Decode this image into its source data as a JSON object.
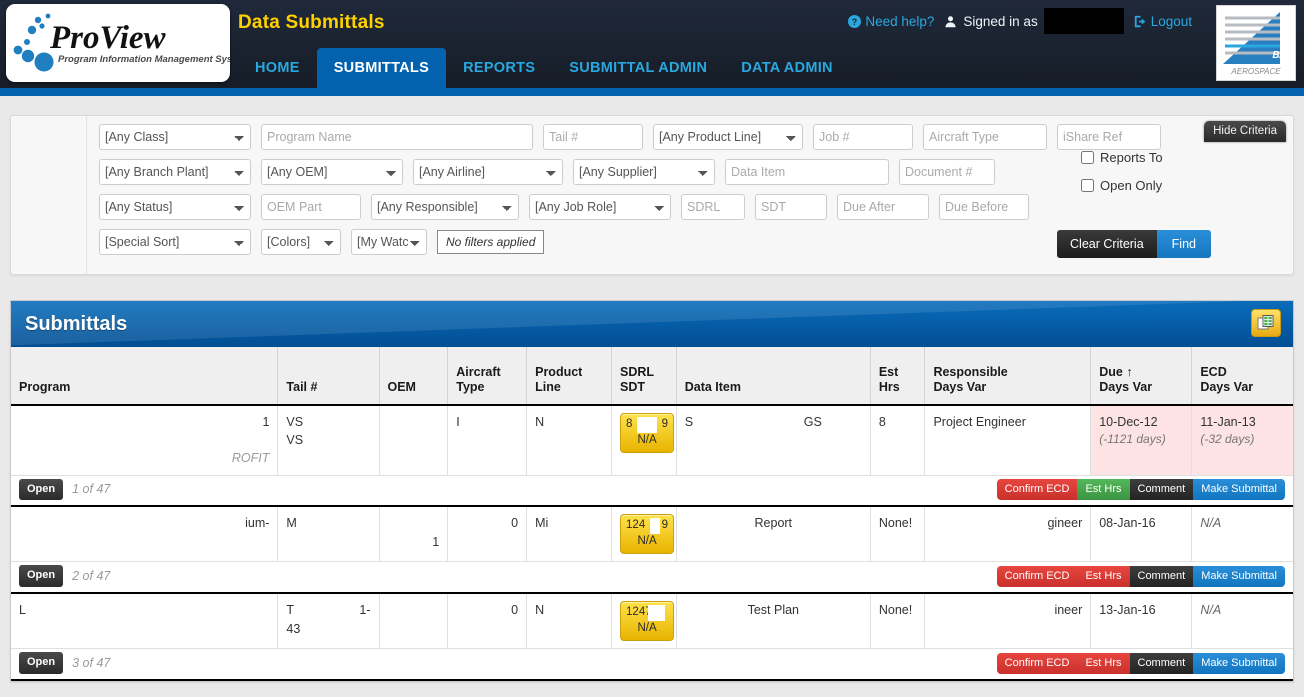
{
  "header": {
    "app_title": "Data Submittals",
    "logo_name": "ProView",
    "logo_tagline": "Program Information Management System",
    "need_help": "Need help?",
    "signed_in_as": "Signed in as",
    "logout": "Logout",
    "be_logo_line1": "B/E",
    "be_logo_line2": "AEROSPACE",
    "nav": [
      {
        "label": "HOME",
        "active": false
      },
      {
        "label": "SUBMITTALS",
        "active": true
      },
      {
        "label": "REPORTS",
        "active": false
      },
      {
        "label": "SUBMITTAL ADMIN",
        "active": false
      },
      {
        "label": "DATA ADMIN",
        "active": false
      }
    ]
  },
  "criteria": {
    "hide_criteria": "Hide Criteria",
    "class": "[Any Class]",
    "program_name_placeholder": "Program Name",
    "tail_placeholder": "Tail #",
    "product_line": "[Any Product Line]",
    "job_placeholder": "Job #",
    "aircraft_type_placeholder": "Aircraft Type",
    "ishare_ref_placeholder": "iShare Ref",
    "branch_plant": "[Any Branch Plant]",
    "oem": "[Any OEM]",
    "airline": "[Any Airline]",
    "supplier": "[Any Supplier]",
    "data_item_placeholder": "Data Item",
    "document_placeholder": "Document #",
    "status": "[Any Status]",
    "oem_part_placeholder": "OEM Part",
    "responsible": "[Any Responsible]",
    "job_role": "[Any Job Role]",
    "sdrl_placeholder": "SDRL",
    "sdt_placeholder": "SDT",
    "due_after_placeholder": "Due After",
    "due_before_placeholder": "Due Before",
    "special_sort": "[Special Sort]",
    "colors": "[Colors]",
    "my_watch": "[My Watc",
    "no_filters": "No filters applied",
    "reports_to": "Reports To",
    "open_only": "Open Only",
    "clear_criteria": "Clear Criteria",
    "find": "Find"
  },
  "grid": {
    "title": "Submittals",
    "export_icon": "export-excel-icon",
    "columns": [
      {
        "key": "program",
        "label": "Program",
        "sort": ""
      },
      {
        "key": "tail",
        "label": "Tail #",
        "sort": ""
      },
      {
        "key": "oem",
        "label": "OEM",
        "sort": ""
      },
      {
        "key": "aircraft_type",
        "label": "Aircraft\nType",
        "line1": "Aircraft",
        "line2": "Type"
      },
      {
        "key": "product_line",
        "label": "Product\nLine",
        "line1": "Product",
        "line2": "Line"
      },
      {
        "key": "sdrl_sdt",
        "label": "SDRL\nSDT",
        "line1": "SDRL",
        "line2": "SDT"
      },
      {
        "key": "data_item",
        "label": "Data Item",
        "line1": "",
        "line2": "Data Item"
      },
      {
        "key": "est_hrs",
        "label": "Est\nHrs",
        "line1": "Est",
        "line2": "Hrs"
      },
      {
        "key": "responsible",
        "label": "Responsible\nDays Var",
        "line1": "Responsible",
        "line2": "Days Var"
      },
      {
        "key": "due",
        "label": "Due ↑\nDays Var",
        "line1": "Due ↑",
        "line2": "Days Var"
      },
      {
        "key": "ecd",
        "label": "ECD\nDays Var",
        "line1": "ECD",
        "line2": "Days Var"
      }
    ],
    "rows": [
      {
        "program_right": "1",
        "program_sub": "ROFIT",
        "tail_line1": "VS",
        "tail_line2": "VS",
        "oem": "",
        "aircraft_type": "I",
        "product_line": "N",
        "sdrl_left": "8",
        "sdrl_right": "9",
        "sdt": "N/A",
        "data_item_left": "S",
        "data_item_right": "GS",
        "est_hrs": "8",
        "est_hrs_none": false,
        "responsible": "Project Engineer",
        "due_date": "10-Dec-12",
        "due_var": "(-1121 days)",
        "due_overdue": true,
        "ecd_date": "11-Jan-13",
        "ecd_var": "(-32 days)",
        "ecd_overdue": true,
        "ecd_na": false,
        "open_label": "Open",
        "count_label": "1 of 47",
        "actions": [
          {
            "label": "Confirm ECD",
            "color": "red"
          },
          {
            "label": "Est Hrs",
            "color": "green"
          },
          {
            "label": "Comment",
            "color": "dark"
          },
          {
            "label": "Make Submittal",
            "color": "blue"
          }
        ]
      },
      {
        "program_right": "ium-",
        "program_sub": "",
        "tail_line1": "M",
        "tail_line2": "",
        "oem_line2": "1",
        "aircraft_type": "0",
        "product_line": "Mi",
        "sdrl_left": "124",
        "sdrl_right": "9",
        "sdt": "N/A",
        "data_item_left": "",
        "data_item_right": "Report",
        "est_hrs": "None!",
        "est_hrs_none": true,
        "responsible": "gineer",
        "due_date": "08-Jan-16",
        "due_var": "",
        "due_overdue": false,
        "ecd_date": "N/A",
        "ecd_var": "",
        "ecd_overdue": false,
        "ecd_na": true,
        "open_label": "Open",
        "count_label": "2 of 47",
        "actions": [
          {
            "label": "Confirm ECD",
            "color": "red"
          },
          {
            "label": "Est Hrs",
            "color": "red"
          },
          {
            "label": "Comment",
            "color": "dark"
          },
          {
            "label": "Make Submittal",
            "color": "blue"
          }
        ]
      },
      {
        "program_right": "L",
        "program_sub": "",
        "tail_line1": "T",
        "tail_line1b": "1-",
        "tail_line2": "43",
        "oem": "",
        "aircraft_type": "0",
        "product_line": "N",
        "sdrl_left": "124700",
        "sdrl_right": "",
        "sdt": "N/A",
        "data_item_left": "",
        "data_item_right": "Test Plan",
        "est_hrs": "None!",
        "est_hrs_none": true,
        "responsible": "ineer",
        "due_date": "13-Jan-16",
        "due_var": "",
        "due_overdue": false,
        "ecd_date": "N/A",
        "ecd_var": "",
        "ecd_overdue": false,
        "ecd_na": true,
        "open_label": "Open",
        "count_label": "3 of 47",
        "actions": [
          {
            "label": "Confirm ECD",
            "color": "red"
          },
          {
            "label": "Est Hrs",
            "color": "red"
          },
          {
            "label": "Comment",
            "color": "dark"
          },
          {
            "label": "Make Submittal",
            "color": "blue"
          }
        ]
      }
    ]
  },
  "colors": {
    "brand_blue": "#0461ae",
    "accent_cyan": "#29a8e0",
    "title_yellow": "#ffd100",
    "header_dark": "#1b2430",
    "overdue_pink": "#fde3e3",
    "badge_yellow": "#e8b400",
    "danger_red": "#c9302c",
    "success_green": "#3d9443"
  }
}
